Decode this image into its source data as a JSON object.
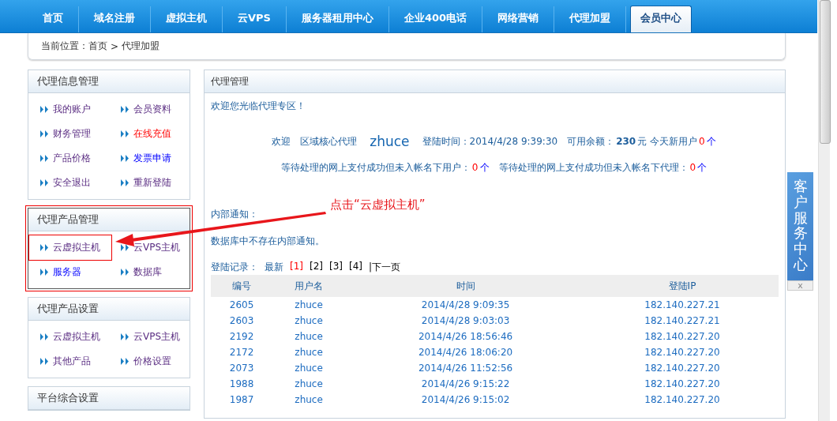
{
  "nav": {
    "tabs": [
      {
        "label": "首页",
        "selected": false
      },
      {
        "label": "域名注册",
        "selected": false
      },
      {
        "label": "虚拟主机",
        "selected": false
      },
      {
        "label": "云VPS",
        "selected": false
      },
      {
        "label": "服务器租用中心",
        "selected": false
      },
      {
        "label": "企业400电话",
        "selected": false
      },
      {
        "label": "网络营销",
        "selected": false
      },
      {
        "label": "代理加盟",
        "selected": false
      },
      {
        "label": "会员中心",
        "selected": true
      }
    ]
  },
  "breadcrumb": {
    "label": "当前位置：",
    "items": [
      "首页",
      "代理加盟"
    ],
    "separator": ">"
  },
  "sidebar": {
    "groups": [
      {
        "title": "代理信息管理",
        "highlighted": false,
        "links": [
          {
            "label": "我的账户",
            "kind": "visited",
            "highlighted": false
          },
          {
            "label": "会员资料",
            "kind": "visited",
            "highlighted": false
          },
          {
            "label": "财务管理",
            "kind": "visited",
            "highlighted": false
          },
          {
            "label": "在线充值",
            "kind": "alert",
            "highlighted": false
          },
          {
            "label": "产品价格",
            "kind": "visited",
            "highlighted": false
          },
          {
            "label": "发票申请",
            "kind": "link",
            "highlighted": false
          },
          {
            "label": "安全退出",
            "kind": "visited",
            "highlighted": false
          },
          {
            "label": "重新登陆",
            "kind": "visited",
            "highlighted": false
          }
        ]
      },
      {
        "title": "代理产品管理",
        "highlighted": true,
        "links": [
          {
            "label": "云虚拟主机",
            "kind": "visited",
            "highlighted": true
          },
          {
            "label": "云VPS主机",
            "kind": "visited",
            "highlighted": false
          },
          {
            "label": "服务器",
            "kind": "link",
            "highlighted": false
          },
          {
            "label": "数据库",
            "kind": "visited",
            "highlighted": false
          }
        ]
      },
      {
        "title": "代理产品设置",
        "highlighted": false,
        "links": [
          {
            "label": "云虚拟主机",
            "kind": "visited",
            "highlighted": false
          },
          {
            "label": "云VPS主机",
            "kind": "visited",
            "highlighted": false
          },
          {
            "label": "其他产品",
            "kind": "visited",
            "highlighted": false
          },
          {
            "label": "价格设置",
            "kind": "visited",
            "highlighted": false
          }
        ]
      },
      {
        "title": "平台综合设置",
        "highlighted": false
      }
    ]
  },
  "annotation": {
    "text": "点击“云虚拟主机”"
  },
  "panel": {
    "title": "代理管理",
    "welcome": "欢迎您光临代理专区！",
    "stats": {
      "greeting": "欢迎",
      "role": "区域核心代理",
      "username": "zhuce",
      "login_time": "登陆时间：2014/4/28 9:39:30",
      "balance_label": "可用余额：",
      "balance": "230",
      "new_users_label": "元 今天新用户",
      "new_users": "0",
      "new_users_unit": "个"
    },
    "pending": [
      {
        "label": "等待处理的网上支付成功但未入帐名下用户：",
        "count": "0",
        "unit": "个"
      },
      {
        "label": "等待处理的网上支付成功但未入帐名下代理：",
        "count": "0",
        "unit": "个"
      }
    ],
    "notice_label": "内部通知：",
    "notice": "数据库中不存在内部通知。",
    "login_records": {
      "label": "登陆记录：",
      "latest": "最新",
      "pages": [
        {
          "label": "[1]",
          "selected": true
        },
        {
          "label": "[2]",
          "selected": false
        },
        {
          "label": "[3]",
          "selected": false
        },
        {
          "label": "[4]",
          "selected": false
        }
      ],
      "next": "|下一页"
    },
    "table": {
      "columns": [
        "编号",
        "用户名",
        "时间",
        "登陆IP"
      ],
      "rows": [
        [
          "2605",
          "zhuce",
          "2014/4/28 9:09:35",
          "182.140.227.21"
        ],
        [
          "2603",
          "zhuce",
          "2014/4/28 9:03:03",
          "182.140.227.21"
        ],
        [
          "2192",
          "zhuce",
          "2014/4/26 18:56:46",
          "182.140.227.20"
        ],
        [
          "2172",
          "zhuce",
          "2014/4/26 18:06:20",
          "182.140.227.20"
        ],
        [
          "2073",
          "zhuce",
          "2014/4/26 11:52:56",
          "182.140.227.20"
        ],
        [
          "1988",
          "zhuce",
          "2014/4/26 9:15:22",
          "182.140.227.20"
        ],
        [
          "1987",
          "zhuce",
          "2014/4/26 9:15:02",
          "182.140.227.20"
        ]
      ]
    }
  },
  "service_widget": {
    "title": "客户服务中心",
    "close": "x"
  }
}
